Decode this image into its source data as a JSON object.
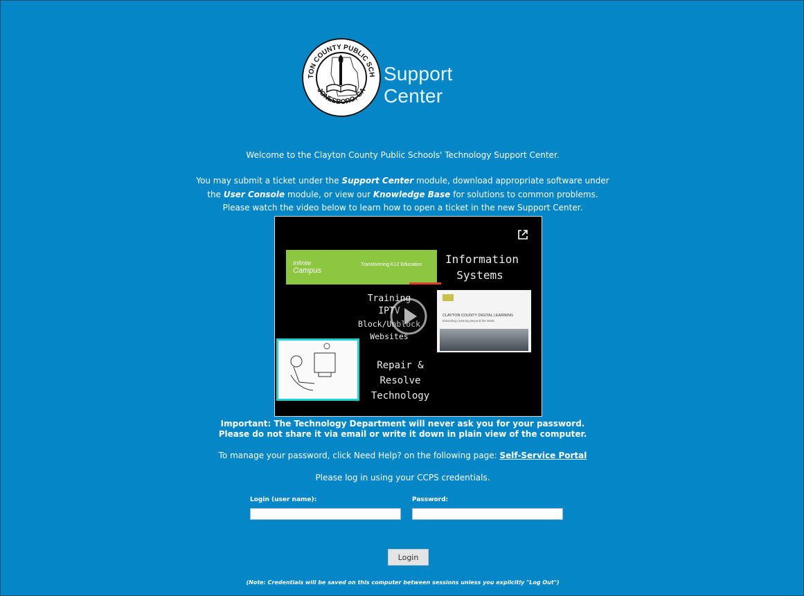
{
  "header": {
    "seal_text_top": "CLAYTON COUNTY PUBLIC SCHOOLS",
    "seal_text_bottom": "JONESBORO, GA",
    "app_title": "Support Center"
  },
  "intro": {
    "welcome": "Welcome to the Clayton County Public Schools' Technology Support Center.",
    "line1_pre": "You may submit a ticket under the ",
    "line1_em": "Support Center",
    "line1_post": " module, download appropriate software under",
    "line2_pre": "the ",
    "line2_em1": "User Console",
    "line2_mid": " module, or view our ",
    "line2_em2": "Knowledge Base",
    "line2_post": " for solutions to common problems.",
    "line3": "Please watch the video below to learn how to open a ticket in the new Support Center."
  },
  "video": {
    "infinite_campus_1": "Infinite",
    "infinite_campus_2": "Campus",
    "transforming": "Transforming K12 Education",
    "info_systems_1": "Information",
    "info_systems_2": "Systems",
    "training": "Training",
    "iptv": "IPTV",
    "block": "Block/Unblock Websites",
    "digital_learning": "CLAYTON COUNTY DIGITAL LEARNING",
    "digital_learning_sub": "Extending Learning Beyond the Walls",
    "repair_1": "Repair & Resolve",
    "repair_2": "Technology"
  },
  "notes": {
    "important1": "Important: The Technology Department will never ask you for your password.",
    "important2": "Please do not share it via email or write it down in plain view of the computer."
  },
  "manage": {
    "text": "To manage your password, click Need Help? on the following page: ",
    "link": "Self-Service Portal"
  },
  "login": {
    "prompt": "Please log in using your CCPS credentials.",
    "username_label": "Login (user name):",
    "username_value": "",
    "password_label": "Password:",
    "password_value": "",
    "button": "Login",
    "note": "(Note: Credentials will be saved on this computer between sessions unless you explicitly \"Log Out\")"
  }
}
